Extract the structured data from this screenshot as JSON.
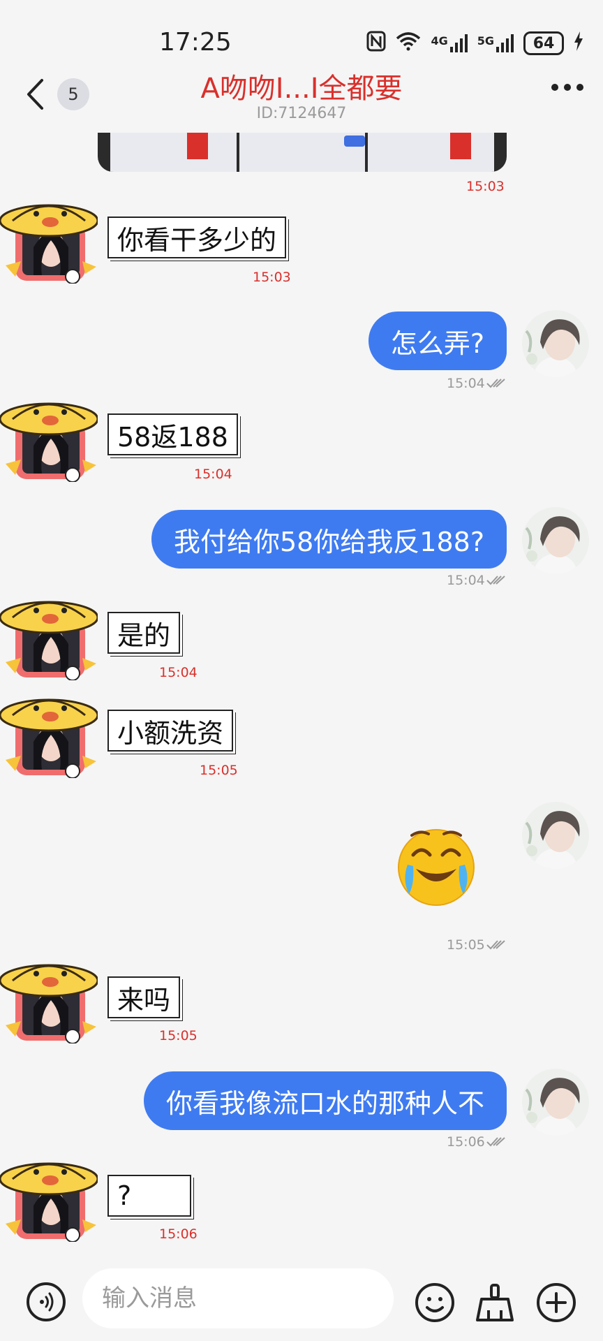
{
  "status_bar": {
    "time": "17:25",
    "network_1": "4G",
    "network_2": "5G",
    "battery": "64"
  },
  "header": {
    "unread_count": "5",
    "title": "A吻吻I...I全都要",
    "subtitle": "ID:7124647"
  },
  "messages": [
    {
      "side": "in",
      "text": "",
      "time": "15:03",
      "type": "image-strip"
    },
    {
      "side": "in",
      "text": "你看干多少的",
      "time": "15:03"
    },
    {
      "side": "out",
      "text": "怎么弄?",
      "time": "15:04"
    },
    {
      "side": "in",
      "text": "58返188",
      "time": "15:04"
    },
    {
      "side": "out",
      "text": "我付给你58你给我反188?",
      "time": "15:04"
    },
    {
      "side": "in",
      "text": "是的",
      "time": "15:04"
    },
    {
      "side": "in",
      "text": "小额洗资",
      "time": "15:05"
    },
    {
      "side": "out",
      "text": "",
      "time": "15:05",
      "type": "emoji",
      "emoji": "laughing-crying-emoji"
    },
    {
      "side": "in",
      "text": "来吗",
      "time": "15:05"
    },
    {
      "side": "out",
      "text": "你看我像流口水的那种人不",
      "time": "15:06"
    },
    {
      "side": "in",
      "text": "?",
      "time": "15:06"
    }
  ],
  "input_bar": {
    "placeholder": "输入消息"
  },
  "colors": {
    "accent_blue": "#3f7bf0",
    "title_red": "#d9302c",
    "background": "#f5f5f5"
  }
}
